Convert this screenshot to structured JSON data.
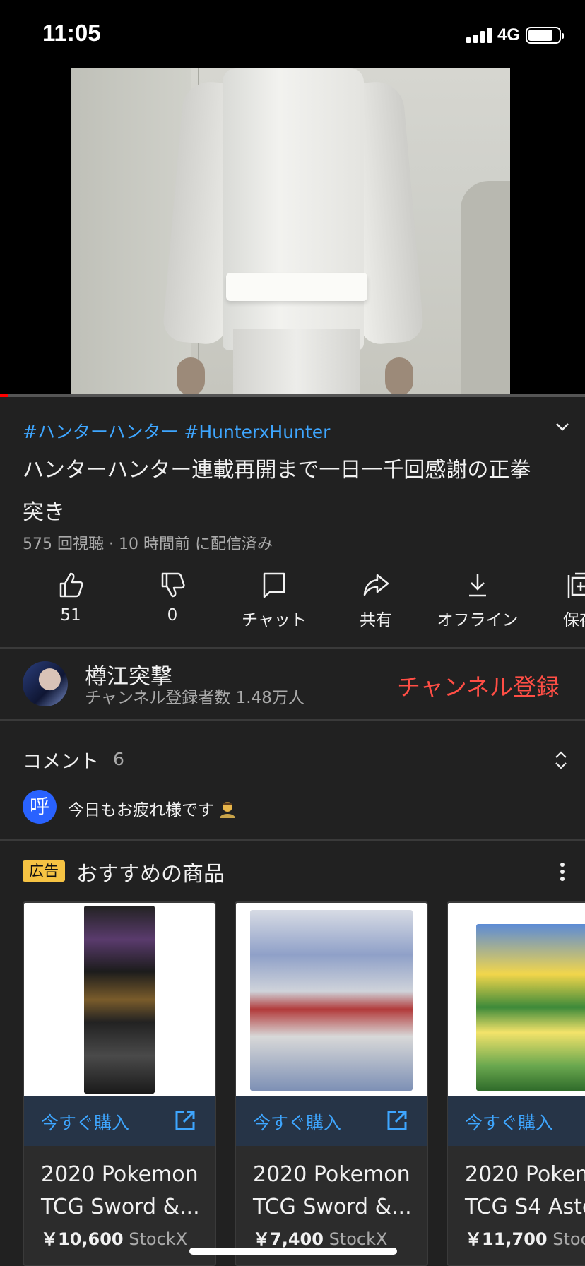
{
  "status_bar": {
    "time": "11:05",
    "network": "4G"
  },
  "video": {
    "progress": 0.015
  },
  "header": {
    "hashtags": "#ハンターハンター #HunterxHunter",
    "title": "ハンターハンター連載再開まで一日一千回感謝の正拳突き",
    "meta": "575 回視聴 · 10 時間前 に配信済み"
  },
  "actions": {
    "like": "51",
    "dislike": "0",
    "chat": "チャット",
    "share": "共有",
    "offline": "オフライン",
    "save": "保存"
  },
  "channel": {
    "name": "樽江突撃",
    "subscribers": "チャンネル登録者数 1.48万人",
    "subscribe": "チャンネル登録"
  },
  "comments": {
    "label": "コメント",
    "count": "6",
    "top_avatar": "呼",
    "top_comment": "今日もお疲れ様です"
  },
  "ad": {
    "badge": "広告",
    "title": "おすすめの商品",
    "buy_label": "今すぐ購入",
    "products": [
      {
        "name": "2020 Pokemon\nTCG Sword &...",
        "price": "￥10,600",
        "seller": "StockX"
      },
      {
        "name": "2020 Pokemon\nTCG Sword &...",
        "price": "￥7,400",
        "seller": "StockX"
      },
      {
        "name": "2020 Pokem\nTCG S4 Asto",
        "price": "￥11,700",
        "seller": "Stoc"
      }
    ]
  },
  "colors": {
    "accent_blue": "#3ea6ff",
    "subscribe_red": "#ff4e45",
    "ad_badge": "#f6c343",
    "background": "#212121"
  }
}
